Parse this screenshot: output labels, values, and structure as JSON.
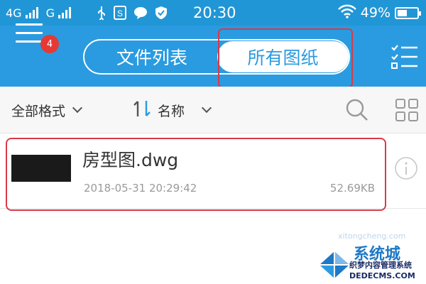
{
  "status_bar": {
    "network_1": "4G",
    "network_2": "G",
    "time": "20:30",
    "battery": "49%",
    "battery_level": 0.49,
    "icons": [
      "usb-icon",
      "s-app-icon",
      "chat-bubble-icon",
      "shield-check-icon",
      "wifi-icon"
    ]
  },
  "header": {
    "notification_count": "4",
    "tabs": [
      {
        "label": "文件列表",
        "selected": false
      },
      {
        "label": "所有图纸",
        "selected": true
      }
    ]
  },
  "toolbar": {
    "format_label": "全部格式",
    "sort_label": "名称"
  },
  "files": [
    {
      "name": "房型图.dwg",
      "modified": "2018-05-31 20:29:42",
      "size": "52.69KB"
    }
  ],
  "watermark": {
    "brand": "系统城",
    "tagline": "织梦内容管理系统",
    "url": "DEDECMS.COM",
    "sub": "xitongcheng.com"
  },
  "colors": {
    "status_bar": "#2196d6",
    "header": "#2a9be0",
    "highlight": "#d83a4a",
    "badge": "#e53935"
  }
}
